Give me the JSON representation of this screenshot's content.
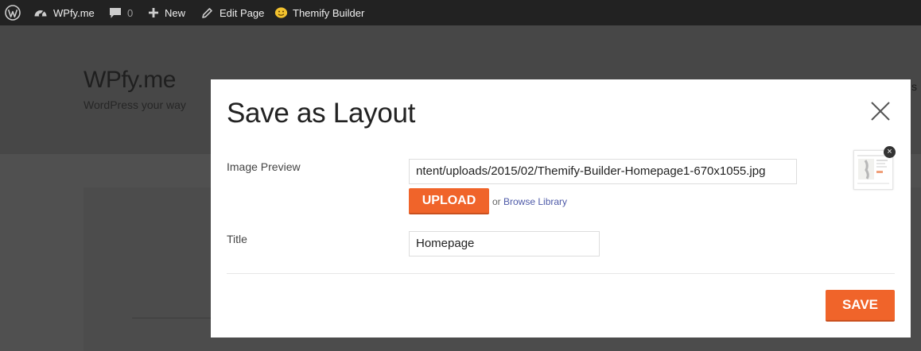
{
  "adminbar": {
    "site_name": "WPfy.me",
    "comments_count": "0",
    "new_label": "New",
    "edit_label": "Edit Page",
    "builder_label": "Themify Builder"
  },
  "site": {
    "title": "WPfy.me",
    "tagline": "WordPress your way",
    "nav_peek": "s"
  },
  "modal": {
    "title": "Save as Layout",
    "image_preview_label": "Image Preview",
    "image_url": "ntent/uploads/2015/02/Themify-Builder-Homepage1-670x1055.jpg",
    "upload_label": "UPLOAD",
    "or_text": "or",
    "browse_label": "Browse Library",
    "title_label": "Title",
    "title_value": "Homepage",
    "save_label": "SAVE",
    "remove_symbol": "×"
  },
  "colors": {
    "accent": "#f0642a",
    "adminbar_bg": "#222222",
    "overlay_bg": "#444444",
    "link": "#4e5aa8"
  }
}
